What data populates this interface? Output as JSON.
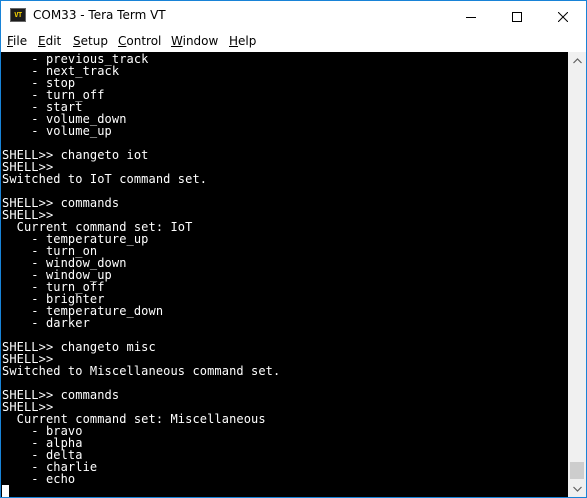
{
  "window": {
    "title": "COM33 - Tera Term VT",
    "icon_text": "VT"
  },
  "colors": {
    "terminal_bg": "#000000",
    "terminal_fg": "#ffffff",
    "window_border": "#1883d7",
    "scroll_thumb": "#cdcdcd"
  },
  "titlebar_buttons": {
    "minimize": "minimize-icon",
    "maximize": "maximize-icon",
    "close": "close-icon"
  },
  "menu": [
    {
      "u": "F",
      "rest": "ile"
    },
    {
      "u": "E",
      "rest": "dit"
    },
    {
      "u": "S",
      "rest": "etup"
    },
    {
      "u": "C",
      "rest": "ontrol"
    },
    {
      "u": "W",
      "rest": "indow"
    },
    {
      "u": "H",
      "rest": "elp"
    }
  ],
  "terminal": {
    "lines": [
      "    - previous_track",
      "    - next_track",
      "    - stop",
      "    - turn_off",
      "    - start",
      "    - volume_down",
      "    - volume_up",
      "",
      "SHELL>> changeto iot",
      "SHELL>>",
      "Switched to IoT command set.",
      "",
      "SHELL>> commands",
      "SHELL>>",
      "  Current command set: IoT",
      "    - temperature_up",
      "    - turn_on",
      "    - window_down",
      "    - window_up",
      "    - turn_off",
      "    - brighter",
      "    - temperature_down",
      "    - darker",
      "",
      "SHELL>> changeto misc",
      "SHELL>>",
      "Switched to Miscellaneous command set.",
      "",
      "SHELL>> commands",
      "SHELL>>",
      "  Current command set: Miscellaneous",
      "    - bravo",
      "    - alpha",
      "    - delta",
      "    - charlie",
      "    - echo",
      ""
    ]
  }
}
